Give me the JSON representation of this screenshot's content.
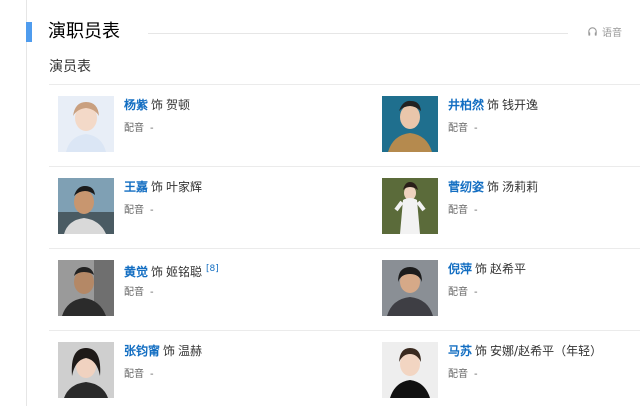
{
  "section": {
    "title": "演职员表",
    "audio_label": "语音"
  },
  "cast": {
    "title": "演员表",
    "role_word": "饰",
    "dub_label": "配音",
    "rows": [
      [
        {
          "actor": "杨紫",
          "role": "贺顿",
          "dub": "-",
          "ref": ""
        },
        {
          "actor": "井柏然",
          "role": "钱开逸",
          "dub": "-",
          "ref": ""
        }
      ],
      [
        {
          "actor": "王嘉",
          "role": "叶家辉",
          "dub": "-",
          "ref": ""
        },
        {
          "actor": "菅纫姿",
          "role": "汤莉莉",
          "dub": "-",
          "ref": ""
        }
      ],
      [
        {
          "actor": "黄觉",
          "role": "姬铭聪",
          "dub": "-",
          "ref": "[8]"
        },
        {
          "actor": "倪萍",
          "role": "赵希平",
          "dub": "-",
          "ref": ""
        }
      ],
      [
        {
          "actor": "张钧甯",
          "role": "温赫",
          "dub": "-",
          "ref": ""
        },
        {
          "actor": "马苏",
          "role": "安娜/赵希平（年轻）",
          "dub": "-",
          "ref": ""
        }
      ]
    ]
  },
  "colors": {
    "accent": "#4f9cee",
    "link": "#136ec2"
  }
}
